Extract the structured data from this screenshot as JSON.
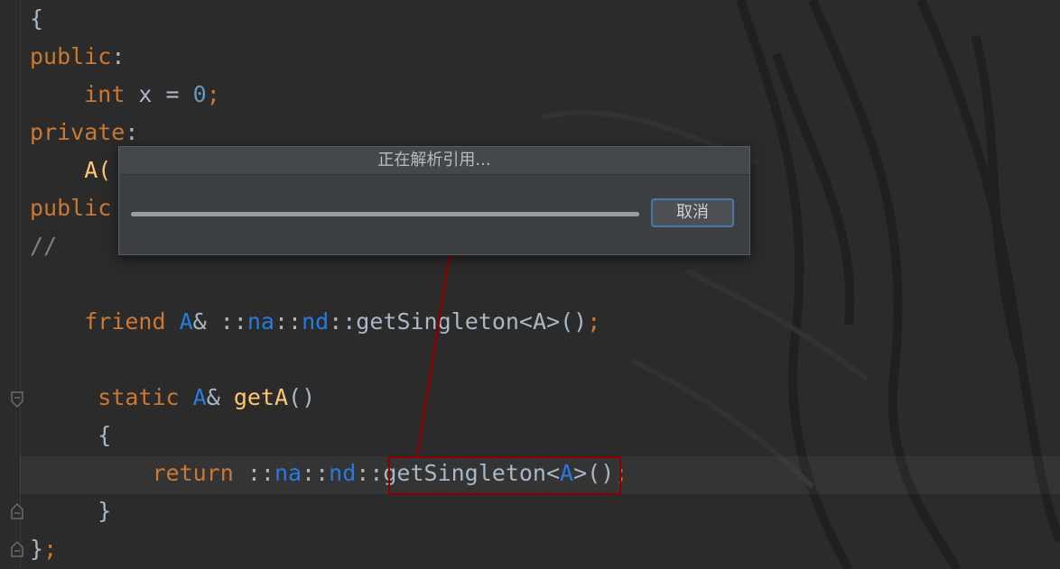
{
  "editor": {
    "lines": [
      [
        {
          "t": "{",
          "c": "plain"
        }
      ],
      [
        {
          "t": "public",
          "c": "kw"
        },
        {
          "t": ":",
          "c": "plain"
        }
      ],
      [
        {
          "t": "    ",
          "c": "plain"
        },
        {
          "t": "int",
          "c": "kw"
        },
        {
          "t": " x = ",
          "c": "plain"
        },
        {
          "t": "0",
          "c": "num"
        },
        {
          "t": ";",
          "c": "kw"
        }
      ],
      [
        {
          "t": "private",
          "c": "kw"
        },
        {
          "t": ":",
          "c": "plain"
        }
      ],
      [
        {
          "t": "    ",
          "c": "plain"
        },
        {
          "t": "A(",
          "c": "fn"
        }
      ],
      [
        {
          "t": "public",
          "c": "kw"
        }
      ],
      [
        {
          "t": "//",
          "c": "cm"
        }
      ],
      [],
      [
        {
          "t": "    ",
          "c": "plain"
        },
        {
          "t": "friend",
          "c": "kw"
        },
        {
          "t": " ",
          "c": "plain"
        },
        {
          "t": "A",
          "c": "ty"
        },
        {
          "t": "& ::",
          "c": "plain"
        },
        {
          "t": "na",
          "c": "ty"
        },
        {
          "t": "::",
          "c": "plain"
        },
        {
          "t": "nd",
          "c": "ty"
        },
        {
          "t": "::getSingleton<A>()",
          "c": "plain"
        },
        {
          "t": ";",
          "c": "kw"
        }
      ],
      [],
      [
        {
          "t": "     ",
          "c": "plain"
        },
        {
          "t": "static",
          "c": "kw"
        },
        {
          "t": " ",
          "c": "plain"
        },
        {
          "t": "A",
          "c": "ty"
        },
        {
          "t": "& ",
          "c": "plain"
        },
        {
          "t": "getA",
          "c": "fn"
        },
        {
          "t": "()",
          "c": "plain"
        }
      ],
      [
        {
          "t": "     {",
          "c": "plain"
        }
      ],
      [
        {
          "t": "         ",
          "c": "plain"
        },
        {
          "t": "return",
          "c": "kw"
        },
        {
          "t": " ::",
          "c": "plain"
        },
        {
          "t": "na",
          "c": "ty"
        },
        {
          "t": "::",
          "c": "plain"
        },
        {
          "t": "nd",
          "c": "ty"
        },
        {
          "t": "::getSingleton<",
          "c": "plain"
        },
        {
          "t": "A",
          "c": "ty"
        },
        {
          "t": ">()",
          "c": "plain"
        },
        {
          "t": ";",
          "c": "kw"
        }
      ],
      [
        {
          "t": "     }",
          "c": "plain"
        }
      ],
      [
        {
          "t": "}",
          "c": "plain"
        },
        {
          "t": ";",
          "c": "kw"
        }
      ]
    ]
  },
  "dialog": {
    "title": "正在解析引用...",
    "cancel_label": "取消",
    "progress": 1.0
  },
  "colors": {
    "keyword": "#cc7832",
    "type": "#287bde",
    "number": "#6897bb",
    "function": "#ffc66d",
    "comment": "#808080",
    "text": "#a9b7c6",
    "annotation": "#8b0000"
  }
}
